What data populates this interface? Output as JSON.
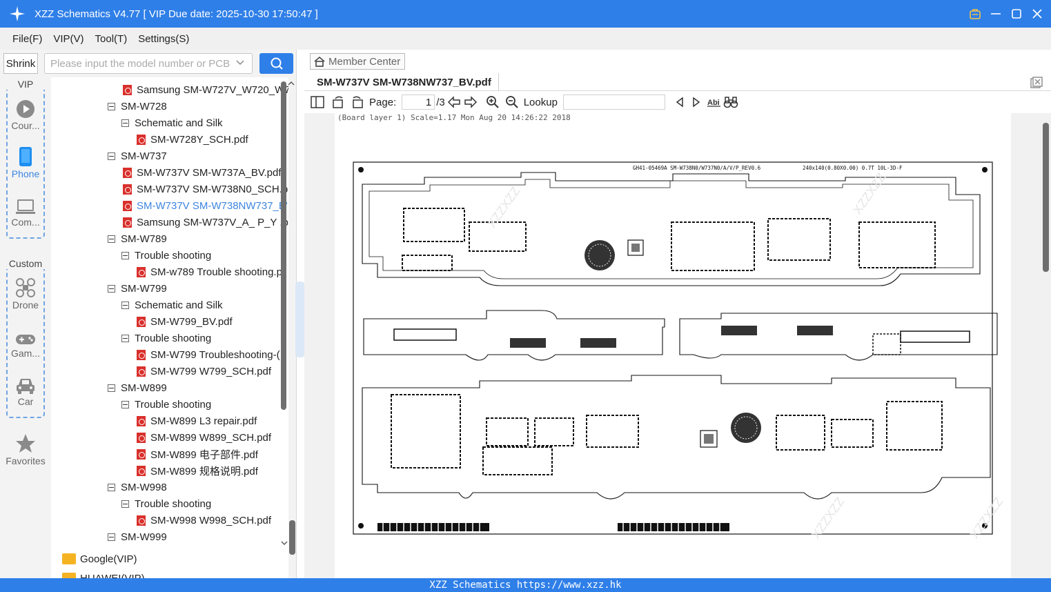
{
  "window": {
    "title": "XZZ Schematics V4.77 [ VIP Due date: 2025-10-30 17:50:47 ]"
  },
  "menu": [
    "File(F)",
    "VIP(V)",
    "Tool(T)",
    "Settings(S)"
  ],
  "search": {
    "shrink_label": "Shrink",
    "placeholder": "Please input the model number or PCB"
  },
  "categories": {
    "vip_label": "VIP",
    "custom_label": "Custom",
    "items": [
      "Cour...",
      "Phone",
      "Com...",
      "Drone",
      "Gam...",
      "Car"
    ],
    "favorites_label": "Favorites",
    "active": "Phone"
  },
  "tree": [
    {
      "type": "pdf",
      "label": "Samsung SM-W727V_W720_W7"
    },
    {
      "type": "group",
      "label": "SM-W728"
    },
    {
      "type": "sub",
      "label": "Schematic and Silk"
    },
    {
      "type": "file",
      "label": "SM-W728Y_SCH.pdf"
    },
    {
      "type": "group",
      "label": "SM-W737"
    },
    {
      "type": "pdf",
      "label": "SM-W737V SM-W737A_BV.pdf"
    },
    {
      "type": "pdf",
      "label": "SM-W737V SM-W738N0_SCH.p"
    },
    {
      "type": "pdf",
      "label": "SM-W737V SM-W738NW737_B'",
      "selected": true
    },
    {
      "type": "pdf",
      "label": "Samsung SM-W737V_A_ P_Y .pc"
    },
    {
      "type": "group",
      "label": "SM-W789"
    },
    {
      "type": "sub",
      "label": "Trouble shooting"
    },
    {
      "type": "file",
      "label": "SM-w789 Trouble shooting.p"
    },
    {
      "type": "group",
      "label": "SM-W799"
    },
    {
      "type": "sub",
      "label": "Schematic and Silk"
    },
    {
      "type": "file",
      "label": "SM-W799_BV.pdf"
    },
    {
      "type": "sub",
      "label": "Trouble shooting"
    },
    {
      "type": "file",
      "label": "SM-W799 Troubleshooting-("
    },
    {
      "type": "file",
      "label": "SM-W799 W799_SCH.pdf"
    },
    {
      "type": "group",
      "label": "SM-W899"
    },
    {
      "type": "sub",
      "label": "Trouble shooting"
    },
    {
      "type": "file",
      "label": "SM-W899 L3 repair.pdf"
    },
    {
      "type": "file",
      "label": "SM-W899 W899_SCH.pdf"
    },
    {
      "type": "file",
      "label": "SM-W899 电子部件.pdf"
    },
    {
      "type": "file",
      "label": "SM-W899 规格说明.pdf"
    },
    {
      "type": "group",
      "label": "SM-W998"
    },
    {
      "type": "sub",
      "label": "Trouble shooting"
    },
    {
      "type": "file",
      "label": "SM-W998 W998_SCH.pdf"
    },
    {
      "type": "group",
      "label": "SM-W999"
    }
  ],
  "folders": [
    "Google(VIP)",
    "HUAWEI(VIP)"
  ],
  "viewer": {
    "member_center": "Member Center",
    "doc_tab": "SM-W737V SM-W738NW737_BV.pdf",
    "page_label": "Page:",
    "page_value": "1",
    "page_total": "/3",
    "lookup_label": "Lookup",
    "page_header": "(Board layer 1) Scale=1.17  Mon Aug 20 14:26:22 2018",
    "board_label": "GH41-05469A  SM-W738N0/W737N0/A/V/P_REV0.6",
    "board_dims": "240x140(0.80X0.00) 0.7T  10L-3D-F",
    "watermark": "XZZXZZ"
  },
  "status": "XZZ Schematics https://www.xzz.hk"
}
